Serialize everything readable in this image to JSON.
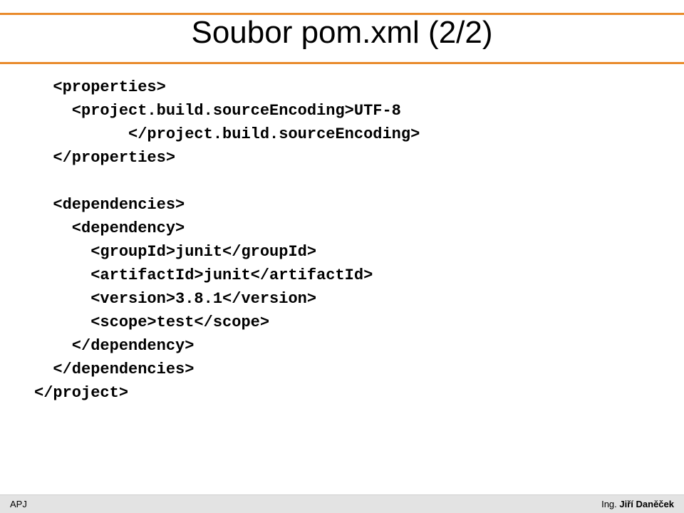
{
  "title": "Soubor pom.xml (2/2)",
  "code": {
    "l1": "  <properties>",
    "l2": "    <project.build.sourceEncoding>UTF-8",
    "l3": "          </project.build.sourceEncoding>",
    "l4": "  </properties>",
    "l5": "",
    "l6": "  <dependencies>",
    "l7": "    <dependency>",
    "l8": "      <groupId>junit</groupId>",
    "l9": "      <artifactId>junit</artifactId>",
    "l10": "      <version>3.8.1</version>",
    "l11": "      <scope>test</scope>",
    "l12": "    </dependency>",
    "l13": "  </dependencies>",
    "l14": "</project>"
  },
  "footer": {
    "left": "APJ",
    "right_prefix": "Ing. ",
    "right_name": "Jiří Daněček"
  }
}
